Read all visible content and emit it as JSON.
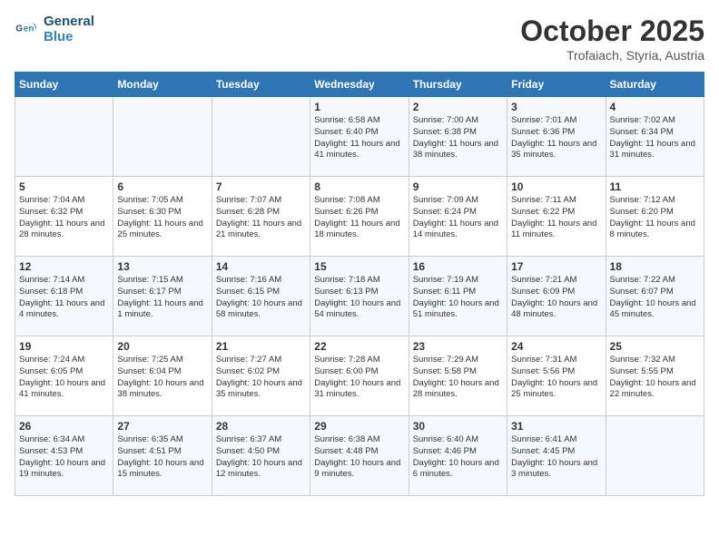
{
  "header": {
    "logo_line1": "General",
    "logo_line2": "Blue",
    "month": "October 2025",
    "location": "Trofaiach, Styria, Austria"
  },
  "days_of_week": [
    "Sunday",
    "Monday",
    "Tuesday",
    "Wednesday",
    "Thursday",
    "Friday",
    "Saturday"
  ],
  "weeks": [
    [
      {
        "day": "",
        "content": ""
      },
      {
        "day": "",
        "content": ""
      },
      {
        "day": "",
        "content": ""
      },
      {
        "day": "1",
        "content": "Sunrise: 6:58 AM\nSunset: 6:40 PM\nDaylight: 11 hours\nand 41 minutes."
      },
      {
        "day": "2",
        "content": "Sunrise: 7:00 AM\nSunset: 6:38 PM\nDaylight: 11 hours\nand 38 minutes."
      },
      {
        "day": "3",
        "content": "Sunrise: 7:01 AM\nSunset: 6:36 PM\nDaylight: 11 hours\nand 35 minutes."
      },
      {
        "day": "4",
        "content": "Sunrise: 7:02 AM\nSunset: 6:34 PM\nDaylight: 11 hours\nand 31 minutes."
      }
    ],
    [
      {
        "day": "5",
        "content": "Sunrise: 7:04 AM\nSunset: 6:32 PM\nDaylight: 11 hours\nand 28 minutes."
      },
      {
        "day": "6",
        "content": "Sunrise: 7:05 AM\nSunset: 6:30 PM\nDaylight: 11 hours\nand 25 minutes."
      },
      {
        "day": "7",
        "content": "Sunrise: 7:07 AM\nSunset: 6:28 PM\nDaylight: 11 hours\nand 21 minutes."
      },
      {
        "day": "8",
        "content": "Sunrise: 7:08 AM\nSunset: 6:26 PM\nDaylight: 11 hours\nand 18 minutes."
      },
      {
        "day": "9",
        "content": "Sunrise: 7:09 AM\nSunset: 6:24 PM\nDaylight: 11 hours\nand 14 minutes."
      },
      {
        "day": "10",
        "content": "Sunrise: 7:11 AM\nSunset: 6:22 PM\nDaylight: 11 hours\nand 11 minutes."
      },
      {
        "day": "11",
        "content": "Sunrise: 7:12 AM\nSunset: 6:20 PM\nDaylight: 11 hours\nand 8 minutes."
      }
    ],
    [
      {
        "day": "12",
        "content": "Sunrise: 7:14 AM\nSunset: 6:18 PM\nDaylight: 11 hours\nand 4 minutes."
      },
      {
        "day": "13",
        "content": "Sunrise: 7:15 AM\nSunset: 6:17 PM\nDaylight: 11 hours\nand 1 minute."
      },
      {
        "day": "14",
        "content": "Sunrise: 7:16 AM\nSunset: 6:15 PM\nDaylight: 10 hours\nand 58 minutes."
      },
      {
        "day": "15",
        "content": "Sunrise: 7:18 AM\nSunset: 6:13 PM\nDaylight: 10 hours\nand 54 minutes."
      },
      {
        "day": "16",
        "content": "Sunrise: 7:19 AM\nSunset: 6:11 PM\nDaylight: 10 hours\nand 51 minutes."
      },
      {
        "day": "17",
        "content": "Sunrise: 7:21 AM\nSunset: 6:09 PM\nDaylight: 10 hours\nand 48 minutes."
      },
      {
        "day": "18",
        "content": "Sunrise: 7:22 AM\nSunset: 6:07 PM\nDaylight: 10 hours\nand 45 minutes."
      }
    ],
    [
      {
        "day": "19",
        "content": "Sunrise: 7:24 AM\nSunset: 6:05 PM\nDaylight: 10 hours\nand 41 minutes."
      },
      {
        "day": "20",
        "content": "Sunrise: 7:25 AM\nSunset: 6:04 PM\nDaylight: 10 hours\nand 38 minutes."
      },
      {
        "day": "21",
        "content": "Sunrise: 7:27 AM\nSunset: 6:02 PM\nDaylight: 10 hours\nand 35 minutes."
      },
      {
        "day": "22",
        "content": "Sunrise: 7:28 AM\nSunset: 6:00 PM\nDaylight: 10 hours\nand 31 minutes."
      },
      {
        "day": "23",
        "content": "Sunrise: 7:29 AM\nSunset: 5:58 PM\nDaylight: 10 hours\nand 28 minutes."
      },
      {
        "day": "24",
        "content": "Sunrise: 7:31 AM\nSunset: 5:56 PM\nDaylight: 10 hours\nand 25 minutes."
      },
      {
        "day": "25",
        "content": "Sunrise: 7:32 AM\nSunset: 5:55 PM\nDaylight: 10 hours\nand 22 minutes."
      }
    ],
    [
      {
        "day": "26",
        "content": "Sunrise: 6:34 AM\nSunset: 4:53 PM\nDaylight: 10 hours\nand 19 minutes."
      },
      {
        "day": "27",
        "content": "Sunrise: 6:35 AM\nSunset: 4:51 PM\nDaylight: 10 hours\nand 15 minutes."
      },
      {
        "day": "28",
        "content": "Sunrise: 6:37 AM\nSunset: 4:50 PM\nDaylight: 10 hours\nand 12 minutes."
      },
      {
        "day": "29",
        "content": "Sunrise: 6:38 AM\nSunset: 4:48 PM\nDaylight: 10 hours\nand 9 minutes."
      },
      {
        "day": "30",
        "content": "Sunrise: 6:40 AM\nSunset: 4:46 PM\nDaylight: 10 hours\nand 6 minutes."
      },
      {
        "day": "31",
        "content": "Sunrise: 6:41 AM\nSunset: 4:45 PM\nDaylight: 10 hours\nand 3 minutes."
      },
      {
        "day": "",
        "content": ""
      }
    ]
  ]
}
